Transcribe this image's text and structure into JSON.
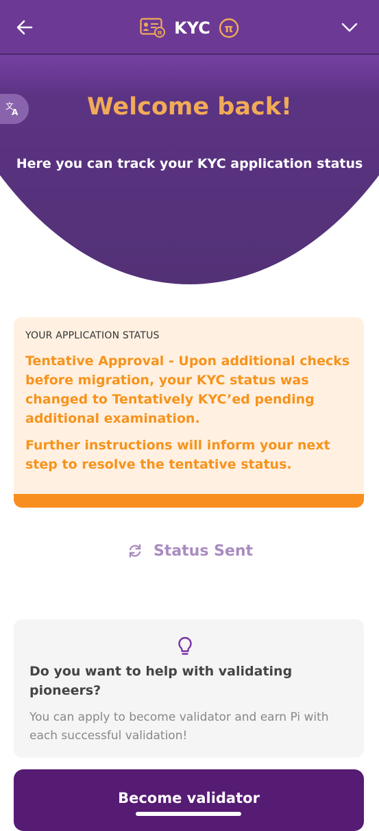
{
  "header": {
    "title": "KYC",
    "back_icon": "arrow-left-icon",
    "kyc_icon": "id-card-pi-icon",
    "pi_icon": "pi-coin-icon",
    "menu_icon": "chevron-down-icon",
    "background": "#6c3a95"
  },
  "hero": {
    "translate_icon": "translate-icon",
    "welcome": "Welcome back!",
    "subtitle": "Here you can track your KYC application status",
    "welcome_color": "#f1ab57"
  },
  "status_card": {
    "heading": "YOUR APPLICATION STATUS",
    "paragraph_1": "Tentative Approval - Upon additional checks before migration, your KYC status was changed to Tentatively KYC’ed pending additional examination.",
    "paragraph_2": "Further instructions will inform your next step to resolve the tentative status.",
    "accent_color": "#f88e1f"
  },
  "status_sent": {
    "icon": "sync-icon",
    "label": "Status Sent"
  },
  "validator_card": {
    "icon": "lightbulb-icon",
    "title": "Do you want to help with validating pioneers?",
    "description": "You can apply to become validator and earn Pi with each successful validation!"
  },
  "cta": {
    "label": "Become validator",
    "color": "#561b73"
  }
}
